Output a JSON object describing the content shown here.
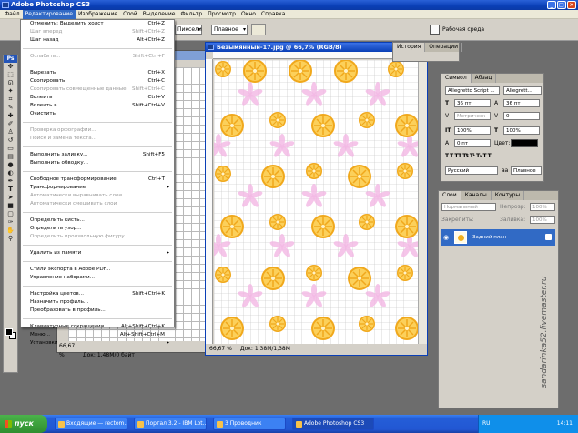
{
  "app": {
    "title": "Adobe Photoshop CS3"
  },
  "menubar": [
    "Файл",
    "Редактирование",
    "Изображение",
    "Слой",
    "Выделение",
    "Фильтр",
    "Просмотр",
    "Окно",
    "Справка"
  ],
  "options": {
    "mode_value": "Пиксели",
    "style_value": "Плавное",
    "zoom_label": "Рабочая среда"
  },
  "edit_menu": [
    {
      "label": "Отменить: Выделить холст",
      "shortcut": "Ctrl+Z",
      "disabled": false
    },
    {
      "label": "Шаг вперед",
      "shortcut": "Shift+Ctrl+Z",
      "disabled": true
    },
    {
      "label": "Шаг назад",
      "shortcut": "Alt+Ctrl+Z",
      "disabled": false
    },
    {
      "sep": true
    },
    {
      "label": "Ослабить...",
      "shortcut": "Shift+Ctrl+F",
      "disabled": true
    },
    {
      "sep": true
    },
    {
      "label": "Вырезать",
      "shortcut": "Ctrl+X",
      "disabled": false
    },
    {
      "label": "Скопировать",
      "shortcut": "Ctrl+C",
      "disabled": false
    },
    {
      "label": "Скопировать совмещенные данные",
      "shortcut": "Shift+Ctrl+C",
      "disabled": true
    },
    {
      "label": "Вклеить",
      "shortcut": "Ctrl+V",
      "disabled": false
    },
    {
      "label": "Вклеить в",
      "shortcut": "Shift+Ctrl+V",
      "disabled": false
    },
    {
      "label": "Очистить",
      "shortcut": "",
      "disabled": false
    },
    {
      "sep": true
    },
    {
      "label": "Проверка орфографии...",
      "shortcut": "",
      "disabled": true
    },
    {
      "label": "Поиск и замена текста...",
      "shortcut": "",
      "disabled": true
    },
    {
      "sep": true
    },
    {
      "label": "Выполнить заливку...",
      "shortcut": "Shift+F5",
      "disabled": false
    },
    {
      "label": "Выполнить обводку...",
      "shortcut": "",
      "disabled": false
    },
    {
      "sep": true
    },
    {
      "label": "Свободное трансформирование",
      "shortcut": "Ctrl+T",
      "disabled": false
    },
    {
      "label": "Трансформирование",
      "shortcut": "",
      "disabled": false,
      "submenu": true
    },
    {
      "label": "Автоматически выравнивать слои...",
      "shortcut": "",
      "disabled": true
    },
    {
      "label": "Автоматически смешивать слои",
      "shortcut": "",
      "disabled": true
    },
    {
      "sep": true
    },
    {
      "label": "Определить кисть...",
      "shortcut": "",
      "disabled": false
    },
    {
      "label": "Определить узор...",
      "shortcut": "",
      "disabled": false
    },
    {
      "label": "Определить произвольную фигуру...",
      "shortcut": "",
      "disabled": true
    },
    {
      "sep": true
    },
    {
      "label": "Удалить из памяти",
      "shortcut": "",
      "disabled": false,
      "submenu": true
    },
    {
      "sep": true
    },
    {
      "label": "Стили экспорта в Adobe PDF...",
      "shortcut": "",
      "disabled": false
    },
    {
      "label": "Управление наборами...",
      "shortcut": "",
      "disabled": false
    },
    {
      "sep": true
    },
    {
      "label": "Настройка цветов...",
      "shortcut": "Shift+Ctrl+K",
      "disabled": false
    },
    {
      "label": "Назначить профиль...",
      "shortcut": "",
      "disabled": false
    },
    {
      "label": "Преобразовать в профиль...",
      "shortcut": "",
      "disabled": false
    },
    {
      "sep": true
    },
    {
      "label": "Клавиатурные сокращения...",
      "shortcut": "Alt+Shift+Ctrl+K",
      "disabled": false
    },
    {
      "label": "Меню...",
      "shortcut": "Alt+Shift+Ctrl+M",
      "disabled": false
    },
    {
      "label": "Установки",
      "shortcut": "",
      "disabled": false,
      "submenu": true
    }
  ],
  "document": {
    "title": "Безымянный-17.jpg @ 66,7% (RGB/8)",
    "zoom": "66,67 %",
    "status": "Док: 1,38M/1,38M"
  },
  "back_document": {
    "zoom": "66,67 %",
    "status": "Док: 1,48M/0 байт"
  },
  "history_panel": {
    "tabs": [
      "История",
      "Операции"
    ]
  },
  "char_panel": {
    "tabs": [
      "Символ",
      "Абзац"
    ],
    "font": "Allegretto Script ...",
    "style": "Allegrett...",
    "size": "36 пт",
    "leading": "36 пт",
    "kerning": "Метрическ",
    "tracking": "0",
    "vscale": "100%",
    "hscale": "100%",
    "baseline": "0 пт",
    "color_label": "Цвет:",
    "language": "Русский",
    "aa_label": "аа",
    "aa_value": "Плавное",
    "text_color": "#000000"
  },
  "layers_panel": {
    "tabs": [
      "Слои",
      "Каналы",
      "Контуры"
    ],
    "blend": "Нормальный",
    "opacity_label": "Непрозр:",
    "opacity": "100%",
    "lock_label": "Закрепить:",
    "fill_label": "Заливка:",
    "fill": "100%",
    "layer_name": "Задний план"
  },
  "watermark": "sandarinka52.livemaster.ru",
  "taskbar": {
    "start": "пуск",
    "tasks": [
      "Входящие — rectom...",
      "Портал 3.2 - IBM Lot...",
      "3 Проводник",
      "Adobe Photoshop CS3"
    ],
    "lang": "RU",
    "clock": "14:11"
  }
}
